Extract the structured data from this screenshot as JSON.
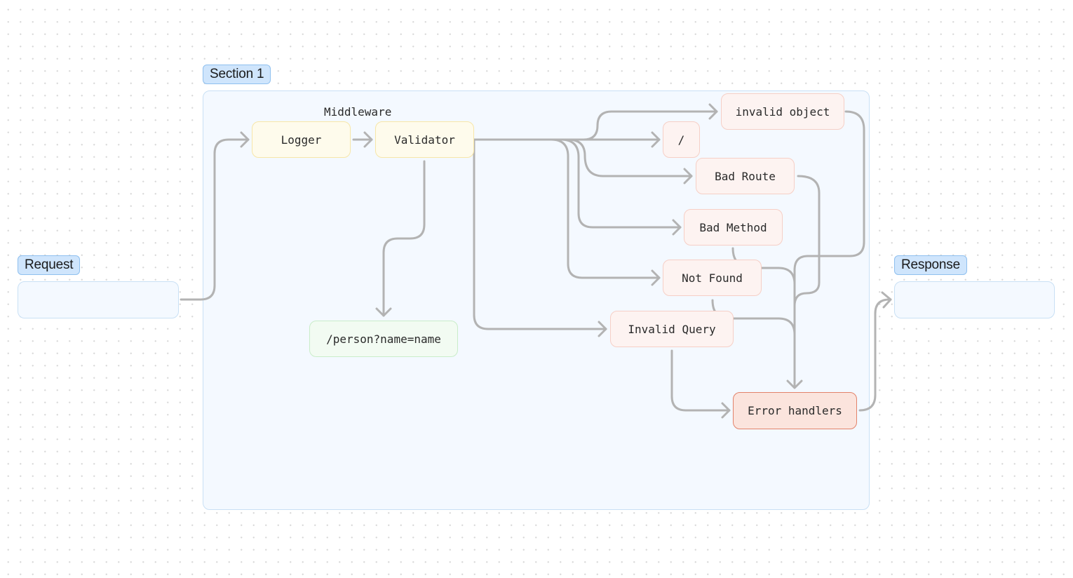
{
  "sections": {
    "request": {
      "label": "Request"
    },
    "response": {
      "label": "Response"
    },
    "section1": {
      "label": "Section 1"
    }
  },
  "groups": {
    "middleware": "Middleware"
  },
  "nodes": {
    "logger": "Logger",
    "validator": "Validator",
    "person_route": "/person?name=name",
    "invalid_object": "invalid object",
    "slash": "/",
    "bad_route": "Bad Route",
    "bad_method": "Bad Method",
    "not_found": "Not Found",
    "invalid_query": "Invalid Query",
    "error_handlers": "Error handlers"
  },
  "edges": [
    {
      "from": "request",
      "to": "logger"
    },
    {
      "from": "logger",
      "to": "validator"
    },
    {
      "from": "validator",
      "to": "person_route"
    },
    {
      "from": "validator",
      "to": "invalid_object"
    },
    {
      "from": "validator",
      "to": "slash"
    },
    {
      "from": "validator",
      "to": "bad_route"
    },
    {
      "from": "validator",
      "to": "bad_method"
    },
    {
      "from": "validator",
      "to": "not_found"
    },
    {
      "from": "validator",
      "to": "invalid_query"
    },
    {
      "from": "invalid_object",
      "to": "error_handlers"
    },
    {
      "from": "bad_route",
      "to": "error_handlers"
    },
    {
      "from": "bad_method",
      "to": "error_handlers"
    },
    {
      "from": "not_found",
      "to": "error_handlers"
    },
    {
      "from": "invalid_query",
      "to": "error_handlers"
    },
    {
      "from": "error_handlers",
      "to": "response"
    }
  ],
  "colors": {
    "section_fill": "#f4f9ff",
    "tag_fill": "#cfe5fc",
    "middleware_fill": "#fefbec",
    "error_case_fill": "#fdf3f1",
    "success_fill": "#f2fbf2",
    "error_handler_fill": "#fbe4dd",
    "edge": "#b3b3b3"
  }
}
